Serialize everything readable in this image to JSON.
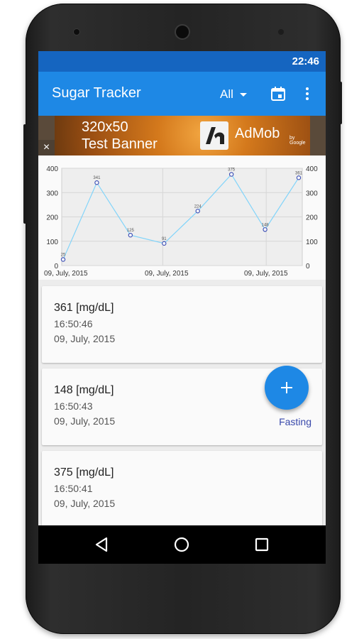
{
  "status_bar": {
    "time": "22:46"
  },
  "app_bar": {
    "title": "Sugar Tracker",
    "filter": {
      "selected": "All"
    },
    "icons": [
      "calendar-icon",
      "overflow-menu-icon"
    ]
  },
  "ad_banner": {
    "line1": "320x50",
    "line2": "Test Banner",
    "brand": "AdMob",
    "brand_sub": "by Google",
    "close": "×"
  },
  "chart_data": {
    "type": "line",
    "x_tick_labels": [
      "09, July, 2015",
      "09, July, 2015",
      "09, July, 2015"
    ],
    "y_ticks": [
      0,
      100,
      200,
      300,
      400
    ],
    "ylim": [
      0,
      400
    ],
    "grid": true,
    "series": [
      {
        "values": [
          25,
          341,
          125,
          91,
          224,
          375,
          148,
          361
        ]
      }
    ],
    "point_labels": [
      "25",
      "341",
      "125",
      "91",
      "224",
      "375",
      "148",
      "361"
    ],
    "colors": {
      "line": "#81d4fa",
      "point": "#3f51b5"
    }
  },
  "entries": [
    {
      "value": "361 [mg/dL]",
      "time": "16:50:46",
      "date": "09, July, 2015",
      "tag": ""
    },
    {
      "value": "148 [mg/dL]",
      "time": "16:50:43",
      "date": "09, July, 2015",
      "tag": "Fasting"
    },
    {
      "value": "375 [mg/dL]",
      "time": "16:50:41",
      "date": "09, July, 2015",
      "tag": ""
    }
  ],
  "fab": {
    "icon": "plus-icon"
  },
  "nav_bar": {
    "icons": [
      "back-icon",
      "home-icon",
      "recents-icon"
    ]
  },
  "colors": {
    "primary": "#1e88e5",
    "primary_dark": "#1565c0",
    "tag_text": "#3949ab"
  }
}
